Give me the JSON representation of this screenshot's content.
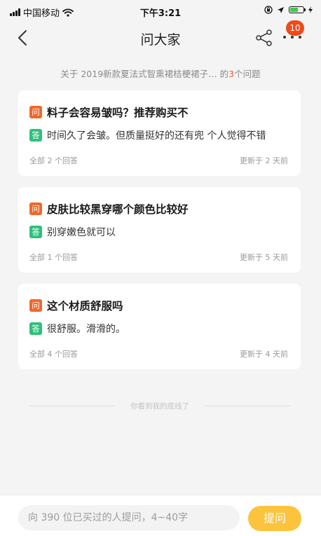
{
  "status_bar": {
    "carrier": "中国移动",
    "time": "下午3:21"
  },
  "nav": {
    "title": "问大家",
    "badge_count": "10"
  },
  "summary": {
    "prefix": "关于 2019新款夏法式智熏裙桔梗裙子…  的",
    "count": "3",
    "suffix": "个问题"
  },
  "tags": {
    "question": "问",
    "answer": "答"
  },
  "questions": [
    {
      "question": "料子会容易皱吗？推荐购买不",
      "answer": "时间久了会皱。但质量挺好的还有兜 个人觉得不错",
      "answer_count": "全部 2 个回答",
      "updated": "更新于 2 天前"
    },
    {
      "question": "皮肤比较黑穿哪个颜色比较好",
      "answer": "别穿嫩色就可以",
      "answer_count": "全部 1 个回答",
      "updated": "更新于 5 天前"
    },
    {
      "question": "这个材质舒服吗",
      "answer": "很舒服。滑滑的。",
      "answer_count": "全部 4 个回答",
      "updated": "更新于 4 天前"
    }
  ],
  "footer": {
    "end_text": "你看到我的底线了"
  },
  "ask_bar": {
    "placeholder": "向 390 位已买过的人提问，4~40字",
    "button_label": "提问"
  },
  "colors": {
    "question_tag": "#f0682b",
    "answer_tag": "#2fc07a",
    "badge": "#f04a1a",
    "ask_button": "#fcc33c",
    "count_highlight": "#f0592b"
  }
}
